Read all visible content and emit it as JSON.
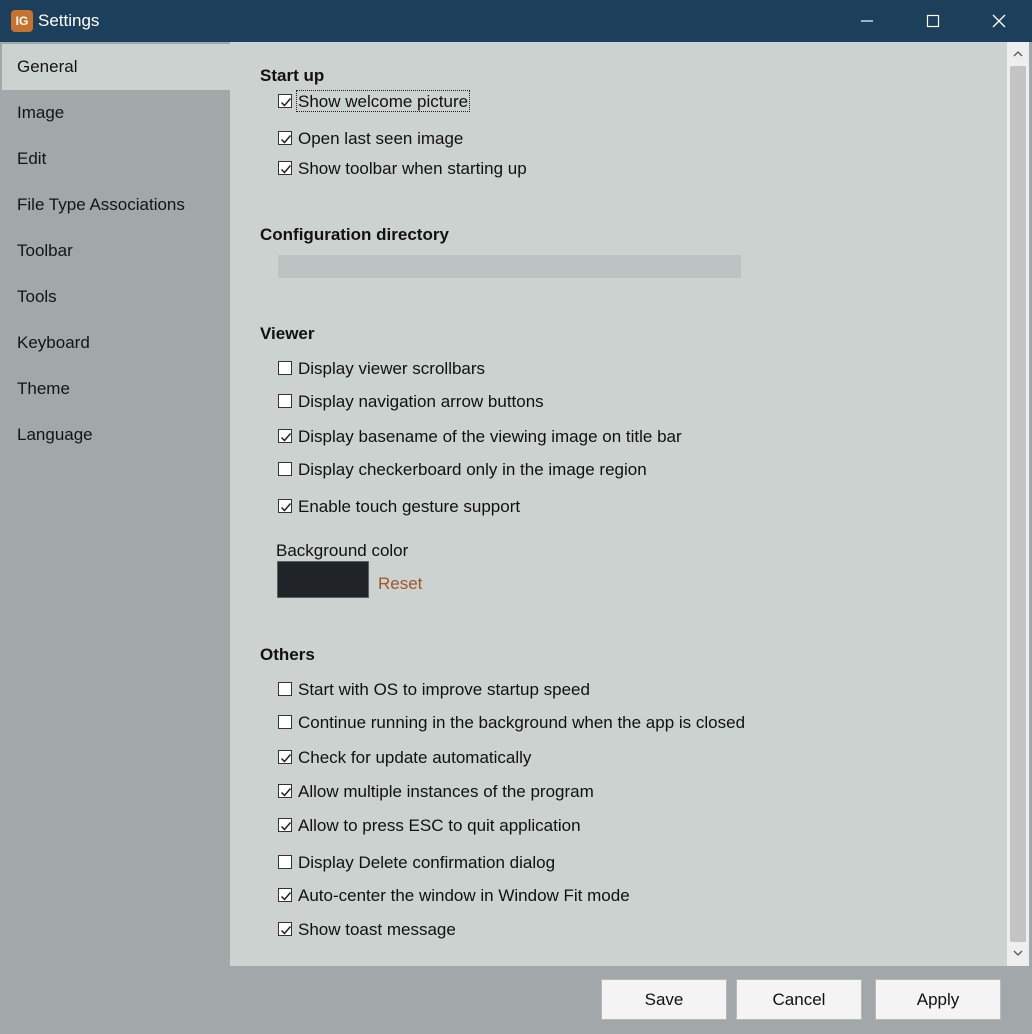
{
  "window": {
    "title": "Settings",
    "app_icon_label": "IG",
    "controls": [
      "minimize-icon",
      "maximize-icon",
      "close-icon"
    ]
  },
  "sidebar": {
    "items": [
      {
        "label": "General",
        "active": true
      },
      {
        "label": "Image"
      },
      {
        "label": "Edit"
      },
      {
        "label": "File Type Associations"
      },
      {
        "label": "Toolbar"
      },
      {
        "label": "Tools"
      },
      {
        "label": "Keyboard"
      },
      {
        "label": "Theme"
      },
      {
        "label": "Language"
      }
    ]
  },
  "startup": {
    "title": "Start up",
    "options": [
      {
        "label": "Show welcome picture",
        "checked": true
      },
      {
        "label": "Open last seen image",
        "checked": true
      },
      {
        "label": "Show toolbar when starting up",
        "checked": true
      }
    ]
  },
  "config_dir": {
    "title": "Configuration directory",
    "value": ""
  },
  "viewer": {
    "title": "Viewer",
    "options": [
      {
        "label": "Display viewer scrollbars",
        "checked": false
      },
      {
        "label": "Display navigation arrow buttons",
        "checked": false
      },
      {
        "label": "Display basename of the viewing image on title bar",
        "checked": true
      },
      {
        "label": "Display checkerboard only in the image region",
        "checked": false
      },
      {
        "label": "Enable touch gesture support",
        "checked": true
      }
    ],
    "background_color_label": "Background color",
    "background_color": "#202428",
    "reset_label": "Reset"
  },
  "others": {
    "title": "Others",
    "options": [
      {
        "label": "Start with OS to improve startup speed",
        "checked": false
      },
      {
        "label": "Continue running in the background when the app is closed",
        "checked": false
      },
      {
        "label": "Check for update automatically",
        "checked": true
      },
      {
        "label": "Allow multiple instances of the program",
        "checked": true
      },
      {
        "label": "Allow to press ESC to quit application",
        "checked": true
      },
      {
        "label": "Display Delete confirmation dialog",
        "checked": false
      },
      {
        "label": "Auto-center the window in Window Fit mode",
        "checked": true
      },
      {
        "label": "Show toast message",
        "checked": true
      }
    ]
  },
  "footer": {
    "save": "Save",
    "cancel": "Cancel",
    "apply": "Apply"
  },
  "colors": {
    "titlebar": "#1c3f5c",
    "sidebar": "#a2a7aa",
    "content": "#ccd2d0",
    "accent_link": "#a0562a"
  }
}
